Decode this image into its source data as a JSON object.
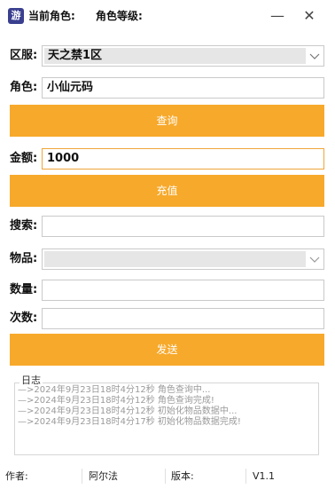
{
  "window": {
    "title_role": "当前角色:",
    "title_level": "角色等级:",
    "minimize_glyph": "—",
    "close_glyph": "✕"
  },
  "form": {
    "server_label": "区服:",
    "server_value": "天之禁1区",
    "role_label": "角色:",
    "role_value": "小仙元码",
    "query_button": "查询",
    "amount_label": "金额:",
    "amount_value": "1000",
    "recharge_button": "充值",
    "search_label": "搜索:",
    "search_value": "",
    "item_label": "物品:",
    "item_value": "",
    "quantity_label": "数量:",
    "quantity_value": "",
    "times_label": "次数:",
    "times_value": "",
    "send_button": "发送"
  },
  "log": {
    "title": "日志",
    "lines": [
      "—>2024年9月23日18时4分12秒 角色查询中...",
      "—>2024年9月23日18时4分12秒 角色查询完成!",
      "—>2024年9月23日18时4分12秒 初始化物品数据中...",
      "—>2024年9月23日18时4分17秒 初始化物品数据完成!"
    ]
  },
  "status": {
    "author_label": "作者:",
    "author_value": "阿尔法",
    "version_label": "版本:",
    "version_value": "V1.1"
  },
  "colors": {
    "accent": "#f7a92b",
    "focus_border": "#f0a53a",
    "log_text": "#9a9a9a"
  },
  "icons": [
    "app-icon",
    "chevron-down-icon"
  ]
}
